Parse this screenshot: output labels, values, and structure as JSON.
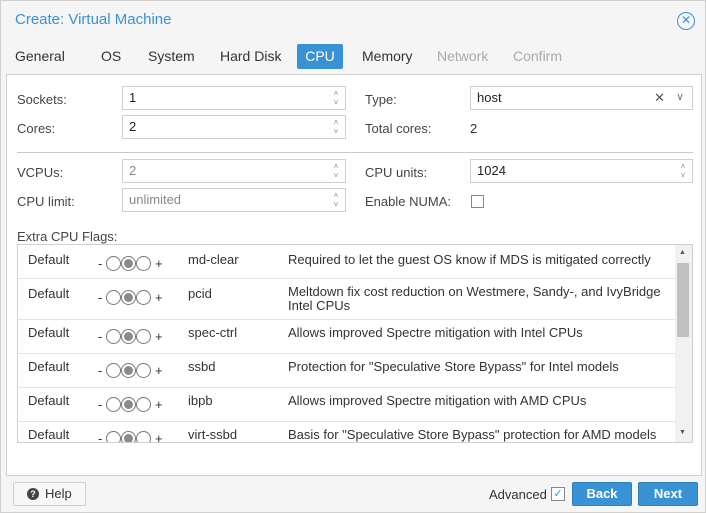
{
  "window": {
    "title": "Create: Virtual Machine",
    "close_icon": "close-circle-icon"
  },
  "tabs": [
    {
      "label": "General",
      "state": "normal"
    },
    {
      "label": "OS",
      "state": "normal"
    },
    {
      "label": "System",
      "state": "normal"
    },
    {
      "label": "Hard Disk",
      "state": "normal"
    },
    {
      "label": "CPU",
      "state": "active"
    },
    {
      "label": "Memory",
      "state": "normal"
    },
    {
      "label": "Network",
      "state": "disabled"
    },
    {
      "label": "Confirm",
      "state": "disabled"
    }
  ],
  "form": {
    "sockets": {
      "label": "Sockets:",
      "value": "1"
    },
    "cores": {
      "label": "Cores:",
      "value": "2"
    },
    "type": {
      "label": "Type:",
      "value": "host"
    },
    "total_cores": {
      "label": "Total cores:",
      "value": "2"
    },
    "vcpus": {
      "label": "VCPUs:",
      "value": "2"
    },
    "cpu_units": {
      "label": "CPU units:",
      "value": "1024"
    },
    "cpu_limit": {
      "label": "CPU limit:",
      "value": "unlimited"
    },
    "enable_numa": {
      "label": "Enable NUMA:",
      "checked": false
    }
  },
  "flags": {
    "label": "Extra CPU Flags:",
    "rows": [
      {
        "state": "Default",
        "minus": "-",
        "plus": "+",
        "name": "md-clear",
        "description": "Required to let the guest OS know if MDS is mitigated correctly"
      },
      {
        "state": "Default",
        "minus": "-",
        "plus": "+",
        "name": "pcid",
        "description": "Meltdown fix cost reduction on Westmere, Sandy-, and IvyBridge Intel CPUs"
      },
      {
        "state": "Default",
        "minus": "-",
        "plus": "+",
        "name": "spec-ctrl",
        "description": "Allows improved Spectre mitigation with Intel CPUs"
      },
      {
        "state": "Default",
        "minus": "-",
        "plus": "+",
        "name": "ssbd",
        "description": "Protection for \"Speculative Store Bypass\" for Intel models"
      },
      {
        "state": "Default",
        "minus": "-",
        "plus": "+",
        "name": "ibpb",
        "description": "Allows improved Spectre mitigation with AMD CPUs"
      },
      {
        "state": "Default",
        "minus": "-",
        "plus": "+",
        "name": "virt-ssbd",
        "description": "Basis for \"Speculative Store Bypass\" protection for AMD models"
      }
    ]
  },
  "footer": {
    "help_label": "Help",
    "advanced_label": "Advanced",
    "advanced_checked": true,
    "back_label": "Back",
    "next_label": "Next"
  },
  "colors": {
    "accent": "#3892d4",
    "panel_bg": "#ffffff",
    "window_bg": "#f5f5f5"
  }
}
